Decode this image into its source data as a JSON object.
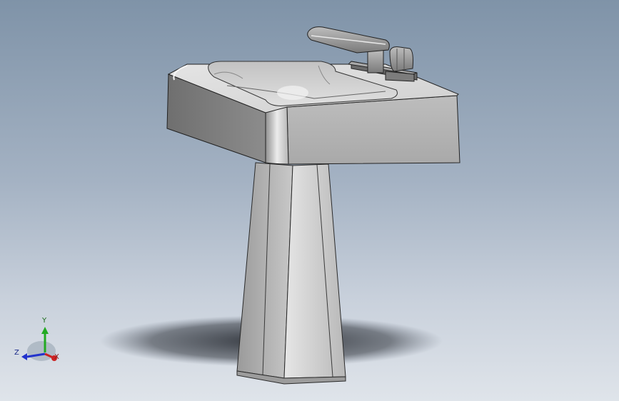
{
  "viewport": {
    "background_top": "#7f93a8",
    "background_bottom": "#dfe4ea",
    "model": "pedestal-sink"
  },
  "triad": {
    "y_label": "Y",
    "z_label": "Z",
    "x_label": "X",
    "y_color": "#22aa22",
    "z_color": "#2233cc",
    "x_color": "#cc2222"
  }
}
